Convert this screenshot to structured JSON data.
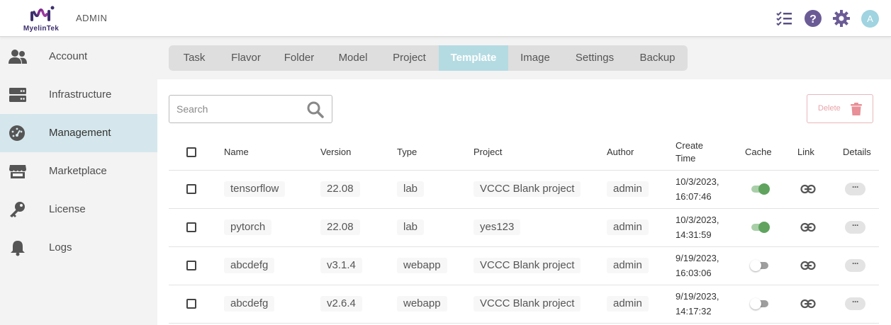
{
  "header": {
    "logo_text": "MyelinTek",
    "admin_label": "ADMIN",
    "avatar_letter": "A",
    "icons": [
      "checklist-icon",
      "help-icon",
      "gear-icon"
    ],
    "accent_color": "#6b5b95"
  },
  "sidebar": {
    "items": [
      {
        "label": "Account",
        "icon": "users-icon"
      },
      {
        "label": "Infrastructure",
        "icon": "server-icon"
      },
      {
        "label": "Management",
        "icon": "gauge-icon",
        "active": true
      },
      {
        "label": "Marketplace",
        "icon": "store-icon"
      },
      {
        "label": "License",
        "icon": "key-icon"
      },
      {
        "label": "Logs",
        "icon": "bell-icon"
      }
    ]
  },
  "tabs": [
    {
      "label": "Task"
    },
    {
      "label": "Flavor"
    },
    {
      "label": "Folder"
    },
    {
      "label": "Model"
    },
    {
      "label": "Project"
    },
    {
      "label": "Template",
      "active": true
    },
    {
      "label": "Image"
    },
    {
      "label": "Settings"
    },
    {
      "label": "Backup"
    }
  ],
  "search": {
    "placeholder": "Search",
    "value": ""
  },
  "delete_button": {
    "label": "Delete"
  },
  "table": {
    "columns": {
      "name": "Name",
      "version": "Version",
      "type": "Type",
      "project": "Project",
      "author": "Author",
      "create_time_line1": "Create",
      "create_time_line2": "Time",
      "cache": "Cache",
      "link": "Link",
      "details": "Details"
    },
    "rows": [
      {
        "name": "tensorflow",
        "version": "22.08",
        "type": "lab",
        "project": "VCCC Blank project",
        "author": "admin",
        "date": "10/3/2023,",
        "time": "16:07:46",
        "cache": true,
        "details": "···"
      },
      {
        "name": "pytorch",
        "version": "22.08",
        "type": "lab",
        "project": "yes123",
        "author": "admin",
        "date": "10/3/2023,",
        "time": "14:31:59",
        "cache": true,
        "details": "···"
      },
      {
        "name": "abcdefg",
        "version": "v3.1.4",
        "type": "webapp",
        "project": "VCCC Blank project",
        "author": "admin",
        "date": "9/19/2023,",
        "time": "16:03:06",
        "cache": false,
        "details": "···"
      },
      {
        "name": "abcdefg",
        "version": "v2.6.4",
        "type": "webapp",
        "project": "VCCC Blank project",
        "author": "admin",
        "date": "9/19/2023,",
        "time": "14:17:32",
        "cache": false,
        "details": "···"
      }
    ]
  }
}
